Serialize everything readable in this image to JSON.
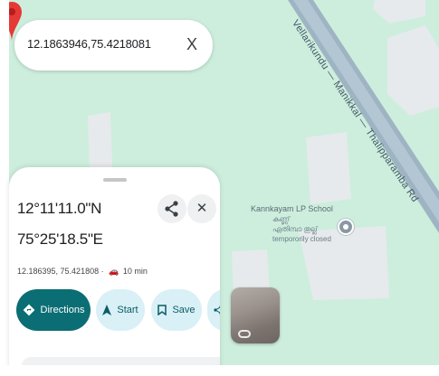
{
  "search": {
    "value": "12.1863946,75.4218081",
    "clear_label": "X"
  },
  "map": {
    "road_label": "Vellarikundu — Manikkal — Thalipparamba Rd",
    "school": {
      "name": "Kannkayam LP School",
      "sub1": "കണ്ണ്",
      "sub2": "ഏതിമ്പാ തുല്ല്",
      "sub3": "tempororily closed"
    },
    "colors": {
      "land": "#cdeedd",
      "road": "#9fb4c3",
      "marker": "#e53935"
    }
  },
  "sheet": {
    "lat": "12°11'11.0\"N",
    "lng": "75°25'18.5\"E",
    "decimal": "12.186395, 75.421808",
    "drive_time": "10 min",
    "actions": {
      "directions": "Directions",
      "start": "Start",
      "save": "Save"
    }
  },
  "icons": [
    "share-icon",
    "close-icon",
    "car-icon",
    "directions-icon",
    "navigation-arrow-icon",
    "bookmark-icon",
    "location-pin-icon",
    "street-view-icon"
  ]
}
